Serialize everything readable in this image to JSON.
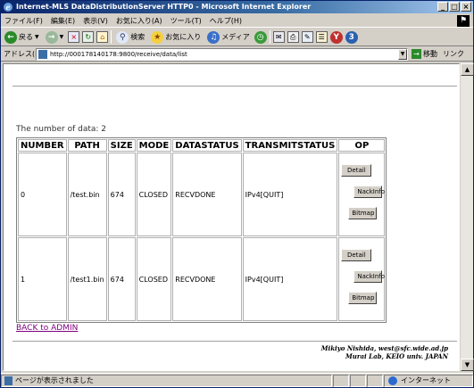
{
  "window": {
    "title": "Internet-MLS DataDistributionServer HTTP0 - Microsoft Internet Explorer",
    "controls": {
      "minimize": "_",
      "maximize": "□",
      "close": "×"
    }
  },
  "menubar": {
    "items": [
      "ファイル(F)",
      "編集(E)",
      "表示(V)",
      "お気に入り(A)",
      "ツール(T)",
      "ヘルプ(H)"
    ]
  },
  "toolbar": {
    "back_label": "戻る",
    "search_label": "検索",
    "favorites_label": "お気に入り",
    "media_label": "メディア"
  },
  "addressbar": {
    "label": "アドレス(D)",
    "url": "http://000178140178:9800/receive/data/list",
    "go_label": "移動",
    "links_label": "リンク"
  },
  "page": {
    "count_text": "The number of data: 2",
    "table": {
      "headers": [
        "NUMBER",
        "PATH",
        "SIZE",
        "MODE",
        "DATASTATUS",
        "TRANSMITSTATUS",
        "OP"
      ],
      "rows": [
        {
          "number": "0",
          "path": "/test.bin",
          "size": "674",
          "mode": "CLOSED",
          "datastatus": "RECVDONE",
          "transmitstatus": "IPv4[QUIT]",
          "op": [
            "Detail",
            "NackInfo",
            "Bitmap"
          ]
        },
        {
          "number": "1",
          "path": "/test1.bin",
          "size": "674",
          "mode": "CLOSED",
          "datastatus": "RECVDONE",
          "transmitstatus": "IPv4[QUIT]",
          "op": [
            "Detail",
            "NackInfo",
            "Bitmap"
          ]
        }
      ]
    },
    "back_link": "BACK to ADMIN",
    "footer": {
      "line1": "Mikiyo Nishida, west@sfc.wide.ad.jp",
      "line2": "Murai Lab, KEIO univ. JAPAN"
    }
  },
  "statusbar": {
    "text": "ページが表示されました",
    "zone": "インターネット"
  },
  "colors": {
    "titlebar": "#0a246a",
    "link_visited": "#800080",
    "chrome": "#d4d0c8"
  }
}
